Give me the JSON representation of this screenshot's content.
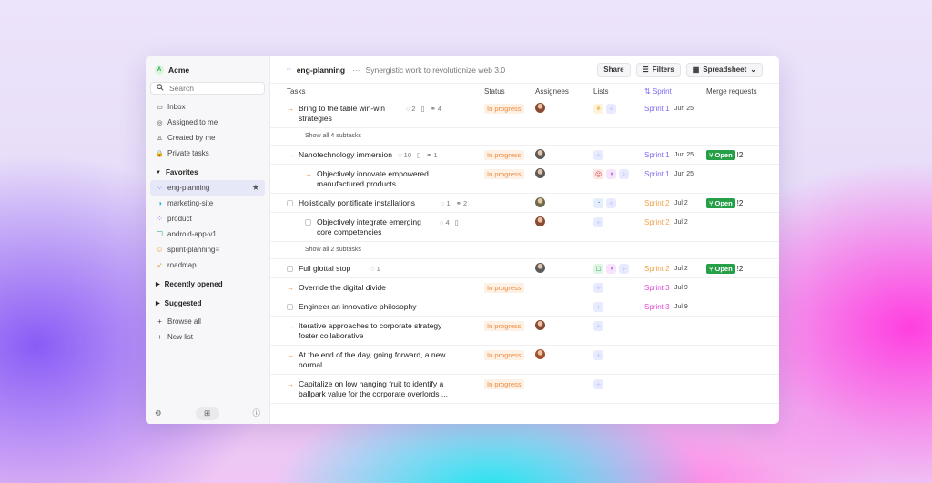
{
  "sidebar": {
    "workspace": "Acme",
    "workspace_logo": "A",
    "search_placeholder": "Search",
    "nav": [
      {
        "label": "Inbox",
        "icon": "inbox-icon",
        "glyph": "▭"
      },
      {
        "label": "Assigned to me",
        "icon": "target-icon",
        "glyph": "◎"
      },
      {
        "label": "Created by me",
        "icon": "user-icon",
        "glyph": "♙"
      },
      {
        "label": "Private tasks",
        "icon": "lock-icon",
        "glyph": "🔒"
      }
    ],
    "favorites_label": "Favorites",
    "favorites": [
      {
        "label": "eng-planning",
        "icon": "grid-icon",
        "glyph": "⁘",
        "color": "#6b7cf5"
      },
      {
        "label": "marketing-site",
        "icon": "half-circle-icon",
        "glyph": "◑",
        "color": "#1bb8d9"
      },
      {
        "label": "product",
        "icon": "grid-icon",
        "glyph": "⁘",
        "color": "#8b5cf6"
      },
      {
        "label": "android-app-v1",
        "icon": "android-icon",
        "glyph": "☐",
        "color": "#2da44e"
      },
      {
        "label": "sprint-planning",
        "icon": "cat-icon",
        "glyph": "☺",
        "color": "#e8a33d"
      },
      {
        "label": "roadmap",
        "icon": "rocket-icon",
        "glyph": "➶",
        "color": "#e8a33d"
      }
    ],
    "recently_opened": "Recently opened",
    "suggested": "Suggested",
    "browse_all": "Browse all",
    "new_list": "New list"
  },
  "header": {
    "project": "eng-planning",
    "description": "Synergistic work to revolutionize web 3.0",
    "share": "Share",
    "filters": "Filters",
    "view": "Spreadsheet"
  },
  "columns": {
    "tasks": "Tasks",
    "status": "Status",
    "assignees": "Assignees",
    "lists": "Lists",
    "sprint": "Sprint",
    "merge_requests": "Merge requests"
  },
  "colors": {
    "in_progress": "#f08a3c",
    "sprint1": "#7c6cf0",
    "sprint2": "#f2a24a",
    "sprint3": "#e04ad8",
    "open": "#25a046"
  },
  "rows": [
    {
      "kind": "task",
      "icon": "arrow",
      "indent": 0,
      "lines": [
        "Bring to the table win-win",
        "strategies"
      ],
      "meta": [
        {
          "icon": "comment-icon",
          "n": "2"
        },
        {
          "icon": "file-icon",
          "n": ""
        },
        {
          "icon": "link-icon",
          "n": "4"
        }
      ],
      "status": "In progress",
      "avatar": "#8a4a33",
      "lists": [
        {
          "g": "⚘",
          "bg": "#fff3dc",
          "c": "#e0a030"
        },
        {
          "g": "⁘",
          "bg": "#e7ebfd",
          "c": "#6b7cf5"
        }
      ],
      "sprint": "Sprint 1",
      "sprint_color": "#7c6cf0",
      "date": "Jun 25",
      "mr": ""
    },
    {
      "kind": "showall",
      "label": "Show all 4 subtasks"
    },
    {
      "kind": "task",
      "icon": "arrow",
      "indent": 0,
      "lines": [
        "Nanotechnology immersion"
      ],
      "meta": [
        {
          "icon": "comment-icon",
          "n": "10"
        },
        {
          "icon": "file-icon",
          "n": ""
        },
        {
          "icon": "link-icon",
          "n": "1"
        }
      ],
      "status": "In progress",
      "avatar": "#5b5b5b",
      "lists": [
        {
          "g": "⁘",
          "bg": "#e7ebfd",
          "c": "#6b7cf5"
        }
      ],
      "sprint": "Sprint 1",
      "sprint_color": "#7c6cf0",
      "date": "Jun 25",
      "mr": "Open",
      "mr_count": "!2"
    },
    {
      "kind": "task",
      "icon": "arrow",
      "indent": 1,
      "lines": [
        "Objectively innovate empowered",
        "manufactured products"
      ],
      "meta": [],
      "status": "In progress",
      "avatar": "#5b5b5b",
      "lists": [
        {
          "g": "☹",
          "bg": "#fde4e4",
          "c": "#e04a4a"
        },
        {
          "g": "◑",
          "bg": "#f5e4fb",
          "c": "#b04ae0"
        },
        {
          "g": "⁘",
          "bg": "#e7ebfd",
          "c": "#6b7cf5"
        }
      ],
      "sprint": "Sprint 1",
      "sprint_color": "#7c6cf0",
      "date": "Jun 25",
      "mr": ""
    },
    {
      "kind": "task",
      "icon": "box",
      "indent": 0,
      "lines": [
        "Holistically pontificate installations"
      ],
      "meta": [
        {
          "icon": "comment-icon",
          "n": "1"
        },
        {
          "icon": "link-icon",
          "n": "2"
        }
      ],
      "status": "",
      "avatar": "#6b6b4a",
      "lists": [
        {
          "g": "◔",
          "bg": "#e4effd",
          "c": "#4a8ae0"
        },
        {
          "g": "⁘",
          "bg": "#e7ebfd",
          "c": "#6b7cf5"
        }
      ],
      "sprint": "Sprint 2",
      "sprint_color": "#f2a24a",
      "date": "Jul 2",
      "mr": "Open",
      "mr_count": "!2"
    },
    {
      "kind": "task",
      "icon": "box",
      "indent": 1,
      "lines": [
        "Objectively integrate emerging",
        "core competencies"
      ],
      "meta": [
        {
          "icon": "comment-icon",
          "n": "4"
        },
        {
          "icon": "file-icon",
          "n": ""
        }
      ],
      "status": "",
      "avatar": "#8a4a33",
      "lists": [
        {
          "g": "⁘",
          "bg": "#e7ebfd",
          "c": "#6b7cf5"
        }
      ],
      "sprint": "Sprint 2",
      "sprint_color": "#f2a24a",
      "date": "Jul 2",
      "mr": ""
    },
    {
      "kind": "showall",
      "label": "Show all 2 subtasks"
    },
    {
      "kind": "task",
      "icon": "box",
      "indent": 0,
      "lines": [
        "Full glottal stop"
      ],
      "meta": [
        {
          "icon": "comment-icon",
          "n": "1"
        }
      ],
      "status": "",
      "avatar": "#5b5b5b",
      "lists": [
        {
          "g": "☐",
          "bg": "#e0f5e4",
          "c": "#2da44e"
        },
        {
          "g": "◑",
          "bg": "#f5e4fb",
          "c": "#b04ae0"
        },
        {
          "g": "⁘",
          "bg": "#e7ebfd",
          "c": "#6b7cf5"
        }
      ],
      "sprint": "Sprint 2",
      "sprint_color": "#f2a24a",
      "date": "Jul 2",
      "mr": "Open",
      "mr_count": "!2"
    },
    {
      "kind": "task",
      "icon": "arrow",
      "indent": 0,
      "lines": [
        "Override the digital divide"
      ],
      "meta": [],
      "status": "In progress",
      "avatar": "",
      "lists": [
        {
          "g": "⁘",
          "bg": "#e7ebfd",
          "c": "#6b7cf5"
        }
      ],
      "sprint": "Sprint 3",
      "sprint_color": "#e04ad8",
      "date": "Jul 9",
      "mr": ""
    },
    {
      "kind": "task",
      "icon": "box",
      "indent": 0,
      "lines": [
        "Engineer an innovative philosophy"
      ],
      "meta": [],
      "status": "",
      "avatar": "",
      "lists": [
        {
          "g": "⁘",
          "bg": "#e7ebfd",
          "c": "#6b7cf5"
        }
      ],
      "sprint": "Sprint 3",
      "sprint_color": "#e04ad8",
      "date": "Jul 9",
      "mr": ""
    },
    {
      "kind": "task",
      "icon": "arrow",
      "indent": 0,
      "lines": [
        "Iterative approaches to corporate strategy",
        "foster collaborative"
      ],
      "meta": [],
      "status": "In progress",
      "avatar": "#8a4a33",
      "lists": [
        {
          "g": "⁘",
          "bg": "#e7ebfd",
          "c": "#6b7cf5"
        }
      ],
      "sprint": "",
      "sprint_color": "",
      "date": "",
      "mr": ""
    },
    {
      "kind": "task",
      "icon": "arrow",
      "indent": 0,
      "lines": [
        "At the end of the day, going forward, a new",
        "normal"
      ],
      "meta": [],
      "status": "In progress",
      "avatar": "#a0522d",
      "lists": [
        {
          "g": "⁘",
          "bg": "#e7ebfd",
          "c": "#6b7cf5"
        }
      ],
      "sprint": "",
      "sprint_color": "",
      "date": "",
      "mr": ""
    },
    {
      "kind": "task",
      "icon": "arrow",
      "indent": 0,
      "lines": [
        "Capitalize on low hanging fruit to identify a",
        "ballpark value for the corporate overlords ..."
      ],
      "meta": [],
      "status": "In progress",
      "avatar": "",
      "lists": [
        {
          "g": "⁘",
          "bg": "#e7ebfd",
          "c": "#6b7cf5"
        }
      ],
      "sprint": "",
      "sprint_color": "",
      "date": "",
      "mr": ""
    }
  ]
}
